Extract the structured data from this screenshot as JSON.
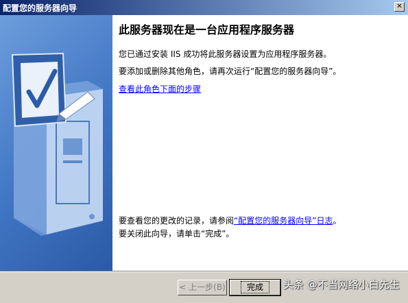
{
  "window": {
    "title": "配置您的服务器向导",
    "close_label": "✕"
  },
  "main": {
    "heading": "此服务器现在是一台应用程序服务器",
    "line1": "您已通过安装 IIS 成功将此服务器设置为应用程序服务器。",
    "line2": "要添加或删除其他角色，请再次运行“配置您的服务器向导”。",
    "steps_link": "查看此角色下面的步骤",
    "log_prefix": "要查看您的更改的记录，请参阅",
    "log_link": "“配置您的服务器向导”日志",
    "log_suffix": "。",
    "close_hint": "要关闭此向导，请单击“完成”。"
  },
  "buttons": {
    "back": "< 上一步(B)",
    "finish": "完成"
  },
  "watermark": "头条 @不当网络小白先生",
  "colors": {
    "title_start": "#0a246a",
    "title_end": "#a6caf0",
    "sidebar": "#3f74c2",
    "link": "#0000ff"
  },
  "icons": {
    "close": "close-icon",
    "sidebar": "checkmark-clipboard-server-illustration"
  }
}
